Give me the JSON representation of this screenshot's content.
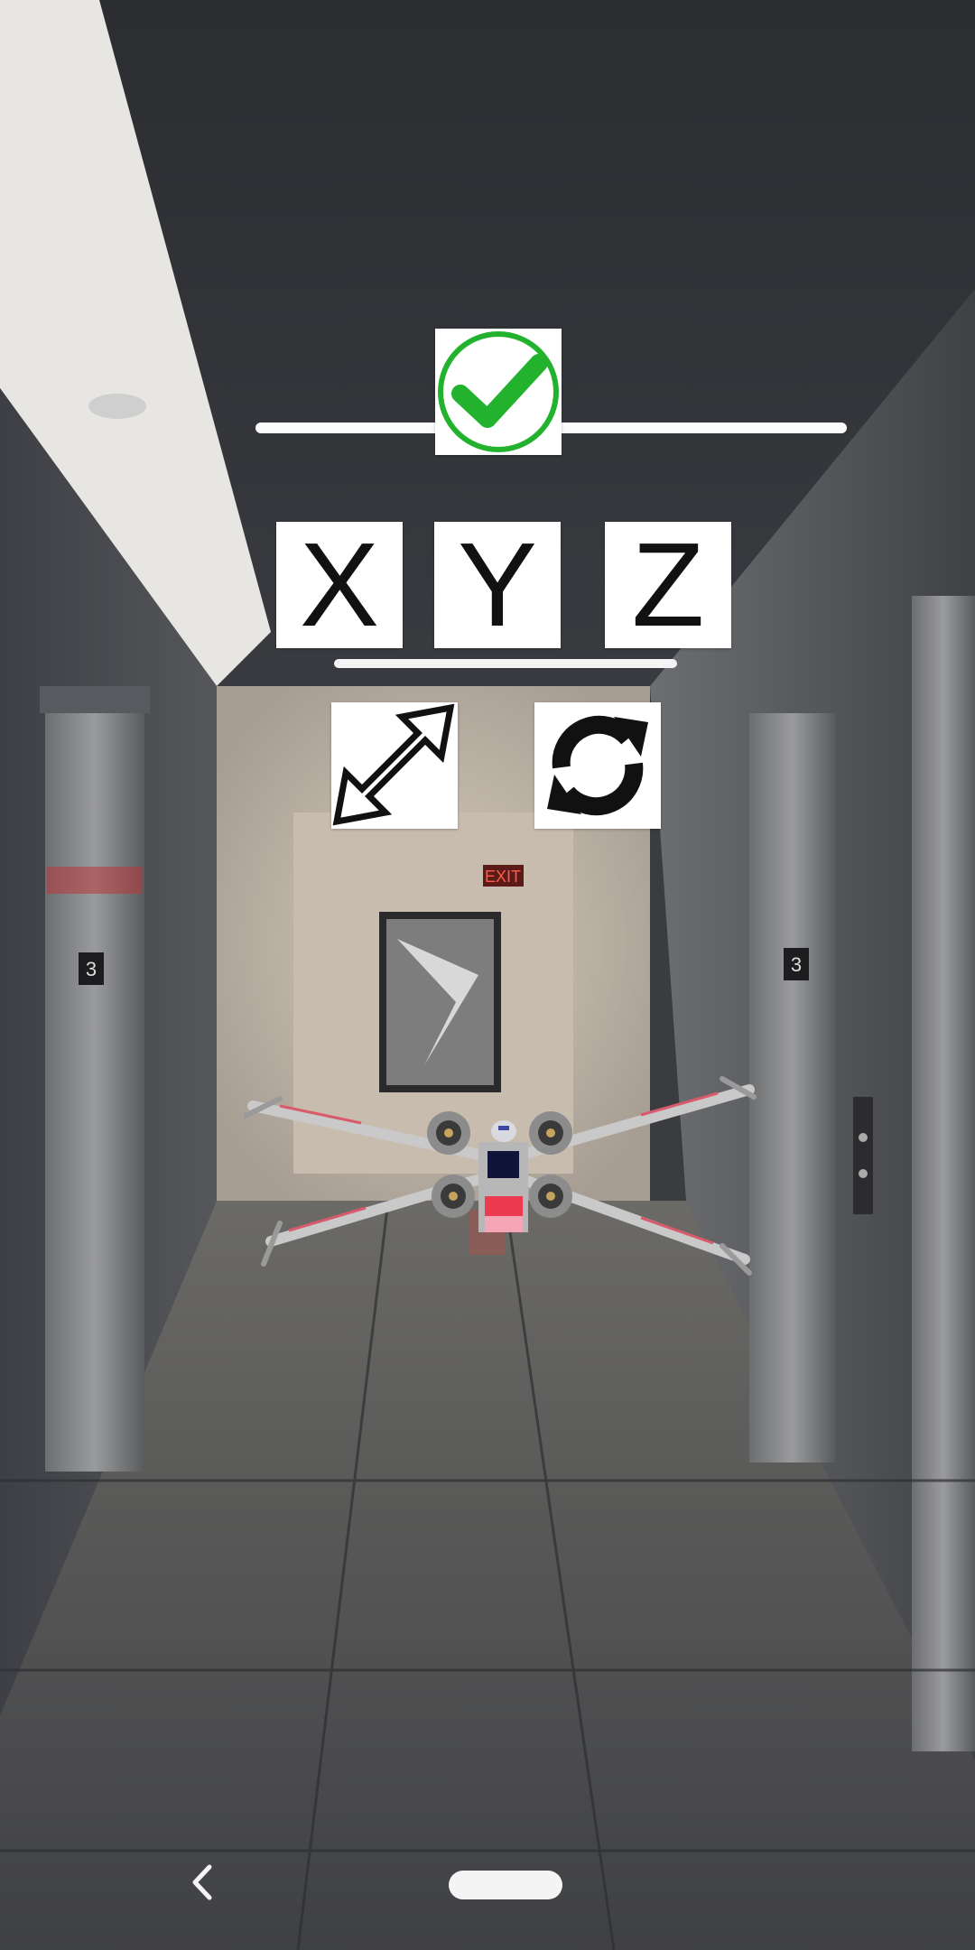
{
  "scene": {
    "type": "ar-camera-view",
    "exit_sign": "EXIT",
    "elevator_floor_left": "3",
    "elevator_floor_right": "3"
  },
  "controls": {
    "confirm": {
      "icon": "check-circle-icon",
      "color": "#22b22e"
    },
    "axes": [
      {
        "id": "x",
        "label": "X"
      },
      {
        "id": "y",
        "label": "Y"
      },
      {
        "id": "z",
        "label": "Z"
      }
    ],
    "scale": {
      "icon": "resize-diagonal-arrow-icon"
    },
    "rotate": {
      "icon": "rotate-refresh-icon"
    }
  },
  "model": {
    "name": "x-wing-model"
  },
  "navbar": {
    "back_icon": "back-chevron-icon",
    "home_icon": "home-pill-icon"
  }
}
